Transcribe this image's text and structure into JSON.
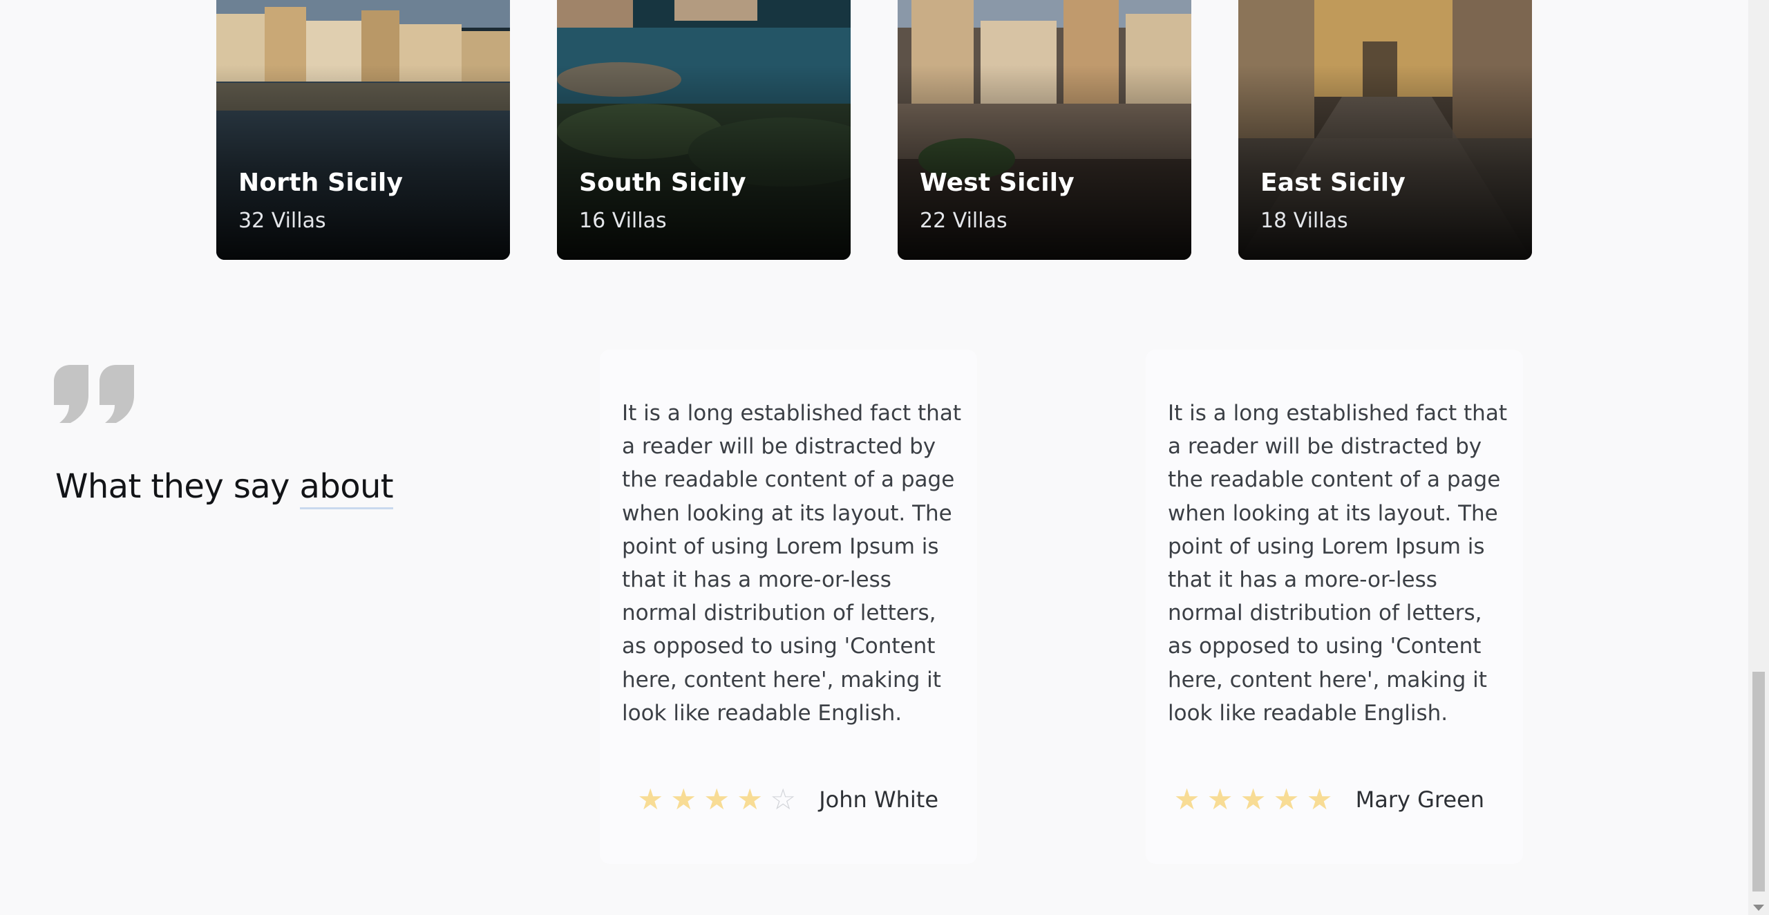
{
  "regions": [
    {
      "name": "North Sicily",
      "count": "32 Villas"
    },
    {
      "name": "South Sicily",
      "count": "16 Villas"
    },
    {
      "name": "West Sicily",
      "count": "22 Villas"
    },
    {
      "name": "East Sicily",
      "count": "18 Villas"
    }
  ],
  "testimonials": {
    "quote_icon": "quote-icon",
    "title_prefix": "What they say",
    "title_link": "about",
    "reviews": [
      {
        "text": "It is a long established fact that a reader will be distracted by the readable content of a page when looking at its layout. The point of using Lorem Ipsum is that it has a more-or-less normal distribution of letters, as opposed to using 'Content here, content here', making it look like readable English.",
        "rating": 4,
        "author": "John White"
      },
      {
        "text": "It is a long established fact that a reader will be distracted by the readable content of a page when looking at its layout. The point of using Lorem Ipsum is that it has a more-or-less normal distribution of letters, as opposed to using 'Content here, content here', making it look like readable English.",
        "rating": 5,
        "author": "Mary Green"
      }
    ]
  },
  "colors": {
    "star_filled": "#f8dc95",
    "star_empty": "#d2d4d9",
    "page_background": "#f9f9fa"
  }
}
